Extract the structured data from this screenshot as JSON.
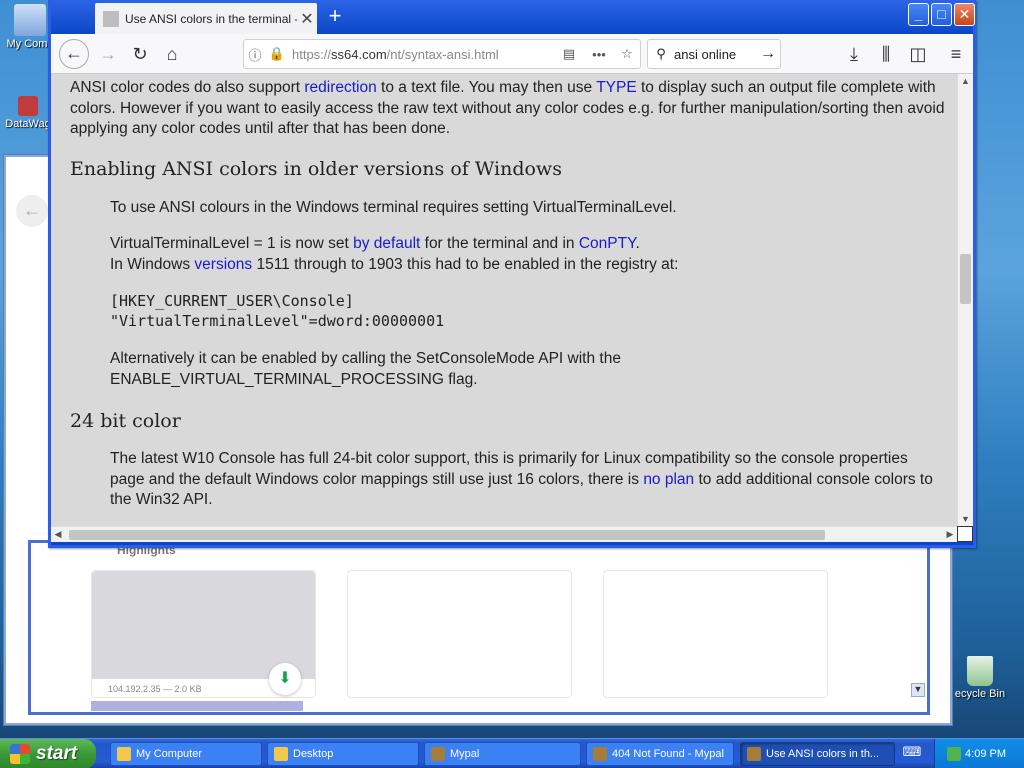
{
  "desktop": {
    "icons": [
      {
        "label": "My Comp"
      },
      {
        "label": "DataWag"
      },
      {
        "label": "ecycle Bin"
      }
    ]
  },
  "background_window": {
    "highlights_label": "Highlights",
    "tile_meta": "104.192.2.35 — 2.0 KB"
  },
  "browser": {
    "tab_title": "Use ANSI colors in the terminal - W",
    "url_prefix": "https://",
    "url_host": "ss64.com",
    "url_path": "/nt/syntax-ansi.html",
    "search_value": "ansi online"
  },
  "page": {
    "p1_a": "ANSI color codes do also support ",
    "p1_link1": "redirection",
    "p1_b": " to a text file. You may then use ",
    "p1_link2": "TYPE",
    "p1_c": " to display such an output file complete with",
    "p1_line2": "colors. However if you want to easily access the raw text without any color codes e.g. for further manipulation/sorting then avoid",
    "p1_line3": "applying any color codes until after that has been done.",
    "h_enabling": "Enabling ANSI colors in older versions of Windows",
    "p2": "To use ANSI colours in the Windows terminal requires setting VirtualTerminalLevel.",
    "p3_a": "VirtualTerminalLevel = 1 is now set ",
    "p3_link1": "by default",
    "p3_b": " for the terminal and in ",
    "p3_link2": "ConPTY",
    "p3_c": ".",
    "p4_a": "In Windows ",
    "p4_link": "versions",
    "p4_b": " 1511 through to 1903 this had to be enabled in the registry at:",
    "code1": "[HKEY_CURRENT_USER\\Console]",
    "code2": "\"VirtualTerminalLevel\"=dword:00000001",
    "p5_line1": "Alternatively it can be enabled by calling the SetConsoleMode API with the",
    "p5_line2": "ENABLE_VIRTUAL_TERMINAL_PROCESSING flag.",
    "h_24bit": "24 bit color",
    "p6_line1": "The latest W10 Console has full 24-bit color support, this is primarily for Linux compatibility so the console properties",
    "p6_a": "page and the default Windows color mappings still use just 16 colors, there is ",
    "p6_link": "no plan",
    "p6_b": " to add additional console colors to",
    "p6_line3": "the Win32 API."
  },
  "taskbar": {
    "start_label": "start",
    "tasks": [
      {
        "label": "My Computer"
      },
      {
        "label": "Desktop"
      },
      {
        "label": "Mypal"
      },
      {
        "label": "404 Not Found - Mypal"
      },
      {
        "label": "Use ANSI colors in th..."
      }
    ],
    "clock": "4:09 PM"
  }
}
